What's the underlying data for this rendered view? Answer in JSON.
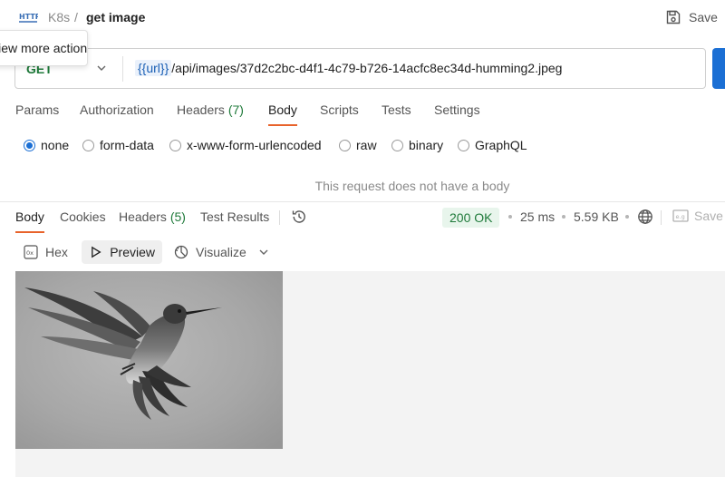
{
  "header": {
    "breadcrumb_parent": "K8s",
    "breadcrumb_separator": "/",
    "request_name": "get image",
    "save_label": "Save",
    "tooltip_text": "View more actions"
  },
  "request": {
    "method": "GET",
    "url_variable": "{{url}}",
    "url_path": "/api/images/37d2c2bc-d4f1-4c79-b726-14acfc8ec34d-humming2.jpeg"
  },
  "request_tabs": [
    {
      "label": "Params",
      "count": ""
    },
    {
      "label": "Authorization",
      "count": ""
    },
    {
      "label": "Headers",
      "count": "(7)"
    },
    {
      "label": "Body",
      "count": "",
      "active": true
    },
    {
      "label": "Scripts",
      "count": ""
    },
    {
      "label": "Tests",
      "count": ""
    },
    {
      "label": "Settings",
      "count": ""
    }
  ],
  "body_types": [
    {
      "label": "none",
      "checked": true
    },
    {
      "label": "form-data"
    },
    {
      "label": "x-www-form-urlencoded"
    },
    {
      "label": "raw"
    },
    {
      "label": "binary"
    },
    {
      "label": "GraphQL"
    }
  ],
  "no_body_message": "This request does not have a body",
  "response": {
    "tabs": [
      {
        "label": "Body",
        "count": "",
        "active": true
      },
      {
        "label": "Cookies",
        "count": ""
      },
      {
        "label": "Headers",
        "count": "(5)"
      },
      {
        "label": "Test Results",
        "count": ""
      }
    ],
    "status": "200 OK",
    "time": "25 ms",
    "size": "5.59 KB",
    "save_label": "Save",
    "view_modes": [
      "Hex",
      "Preview",
      "Visualize"
    ],
    "active_view": "Preview"
  },
  "colors": {
    "accent": "#e8632b",
    "method_get": "#1f7a3a",
    "status_ok_bg": "#e8f5ec",
    "send_button": "#1b6fd4"
  },
  "icons": {
    "collection": "http-icon",
    "save": "save-icon",
    "history": "history-icon",
    "network": "globe-icon",
    "hex": "hex-icon",
    "preview": "play-icon",
    "visualize": "visualize-icon"
  }
}
